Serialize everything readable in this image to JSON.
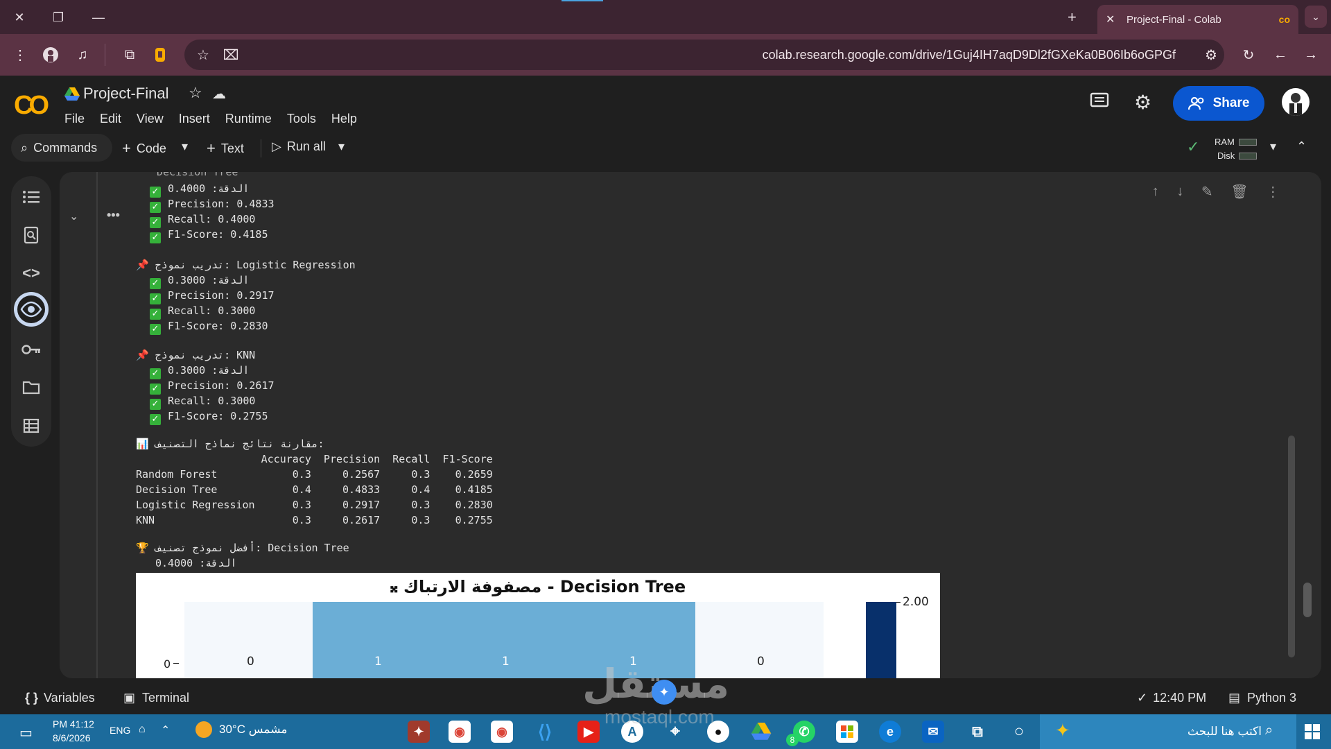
{
  "browser": {
    "tab_title": "Project-Final - Colab",
    "url": "colab.research.google.com/drive/1Guj4IH7aqD9Dl2fGXeKa0B06Ib6oGPGf"
  },
  "colab": {
    "notebook_title": "Project-Final",
    "menu": [
      "File",
      "Edit",
      "View",
      "Insert",
      "Runtime",
      "Tools",
      "Help"
    ],
    "share_label": "Share",
    "commands_label": "Commands",
    "code_label": "Code",
    "text_label": "Text",
    "run_all_label": "Run all",
    "ram_label": "RAM",
    "disk_label": "Disk"
  },
  "output": {
    "top_partial": "Decision Tree",
    "dt": {
      "acc": "0.4000 :الدقة",
      "precision": "Precision: 0.4833",
      "recall": "Recall: 0.4000",
      "f1": "F1-Score: 0.4185"
    },
    "lr": {
      "header": "تدريب نموذج: Logistic Regression",
      "acc": "0.3000 :الدقة",
      "precision": "Precision: 0.2917",
      "recall": "Recall: 0.3000",
      "f1": "F1-Score: 0.2830"
    },
    "knn": {
      "header": "تدريب نموذج: KNN",
      "acc": "0.3000 :الدقة",
      "precision": "Precision: 0.2617",
      "recall": "Recall: 0.3000",
      "f1": "F1-Score: 0.2755"
    },
    "comparison_header": "مقارنة نتائج نماذج التصنيف:",
    "table": {
      "header": "                    Accuracy  Precision  Recall  F1-Score",
      "rows": [
        "Random Forest            0.3     0.2567     0.3    0.2659",
        "Decision Tree            0.4     0.4833     0.4    0.4185",
        "Logistic Regression      0.3     0.2917     0.3    0.2830",
        "KNN                      0.3     0.2617     0.3    0.2755"
      ]
    },
    "best_header": "أفضل نموذج تصنيف: Decision Tree",
    "best_acc": "0.4000 :الدقة"
  },
  "chart": {
    "title": "𝄪 مصفوفة الارتباك - Decision Tree",
    "row_label": "0",
    "cell_values": [
      "0",
      "1",
      "1",
      "1",
      "0"
    ],
    "colorbar_tick": "2.00"
  },
  "status": {
    "variables_label": "Variables",
    "terminal_label": "Terminal",
    "time": "12:40 PM",
    "runtime": "Python 3"
  },
  "taskbar": {
    "clock_time": "PM 41:12",
    "clock_date": "8/6/2026",
    "lang": "ENG",
    "weather": "30°C  مشمس",
    "search_placeholder": "اكتب هنا للبحث",
    "badge": "8"
  },
  "watermark": {
    "main": "مستقل",
    "sub": "mostaql.com"
  }
}
